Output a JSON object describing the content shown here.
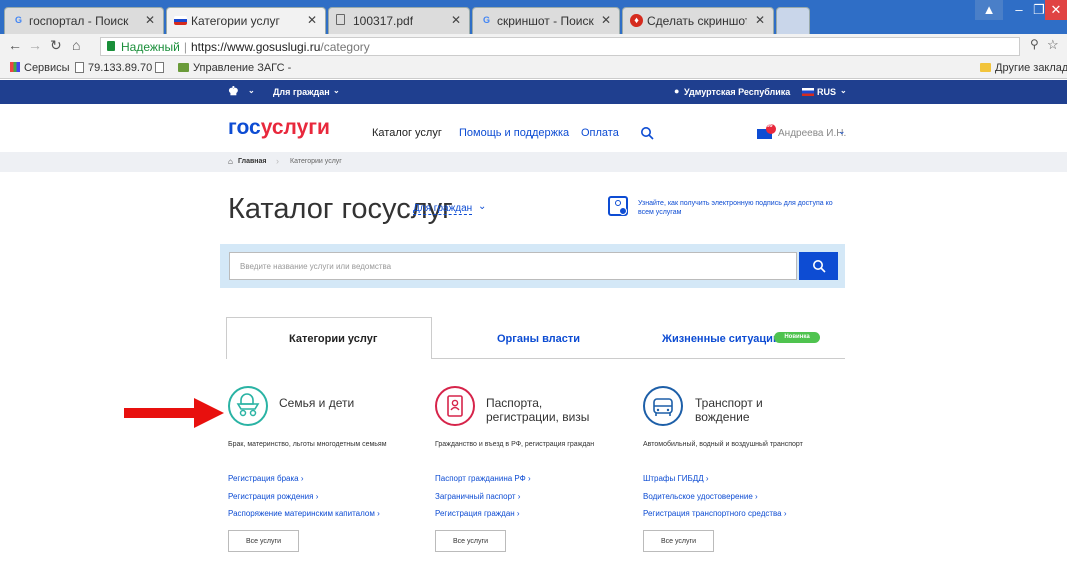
{
  "browser": {
    "tabs": [
      {
        "title": "госпортал - Поиск в Goo",
        "favicon": "google-icon"
      },
      {
        "title": "Категории услуг",
        "favicon": "flag-ru-icon"
      },
      {
        "title": "100317.pdf",
        "favicon": "document-icon"
      },
      {
        "title": "скриншот - Поиск в Goo",
        "favicon": "google-icon"
      },
      {
        "title": "Сделать скриншот — Он",
        "favicon": "lightshot-icon"
      }
    ],
    "secure_label": "Надежный",
    "url_host": "https://www.gosuslugi.ru",
    "url_path": "/category",
    "bookmarks": {
      "apps": "Сервисы",
      "ip": "79.133.89.70",
      "zags": "Управление ЗАГС - ",
      "other": "Другие закладки"
    }
  },
  "site": {
    "topbar": {
      "audience": "Для граждан",
      "region": "Удмуртская Республика",
      "language": "RUS"
    },
    "logo": {
      "part1": "гос",
      "part2": "услуги"
    },
    "nav": {
      "catalog": "Каталог услуг",
      "help": "Помощь и поддержка",
      "payment": "Оплата"
    },
    "user": {
      "name": "Андреева И.Н.",
      "notifications": "99"
    },
    "breadcrumb": {
      "home": "Главная",
      "current": "Категории услуг"
    },
    "page_title": "Каталог госуслуг",
    "audience_select": "Для граждан",
    "esign_text": "Узнайте, как получить электронную подпись для доступа ко всем услугам",
    "search": {
      "placeholder": "Введите название услуги или ведомства"
    },
    "tabs": {
      "categories": "Категории услуг",
      "authorities": "Органы власти",
      "life": "Жизненные ситуации",
      "new_badge": "Новинка"
    },
    "categories": [
      {
        "title": "Семья и дети",
        "desc": "Брак, материнство, льготы многодетным семьям",
        "links": [
          "Регистрация брака",
          "Регистрация рождения",
          "Распоряжение материнским капиталом"
        ],
        "icon": "stroller-icon",
        "color": "#2ab3a4"
      },
      {
        "title_line1": "Паспорта,",
        "title_line2": "регистрации, визы",
        "desc": "Гражданство и въезд в РФ, регистрация граждан",
        "links": [
          "Паспорт гражданина РФ",
          "Заграничный паспорт",
          "Регистрация граждан"
        ],
        "icon": "passport-icon",
        "color": "#d6244a"
      },
      {
        "title_line1": "Транспорт и",
        "title_line2": "вождение",
        "desc": "Автомобильный, водный и воздушный транспорт",
        "links": [
          "Штрафы ГИБДД",
          "Водительское удостоверение",
          "Регистрация транспортного средства"
        ],
        "icon": "car-icon",
        "color": "#1d5fa8"
      }
    ],
    "all_services": "Все услуги"
  }
}
